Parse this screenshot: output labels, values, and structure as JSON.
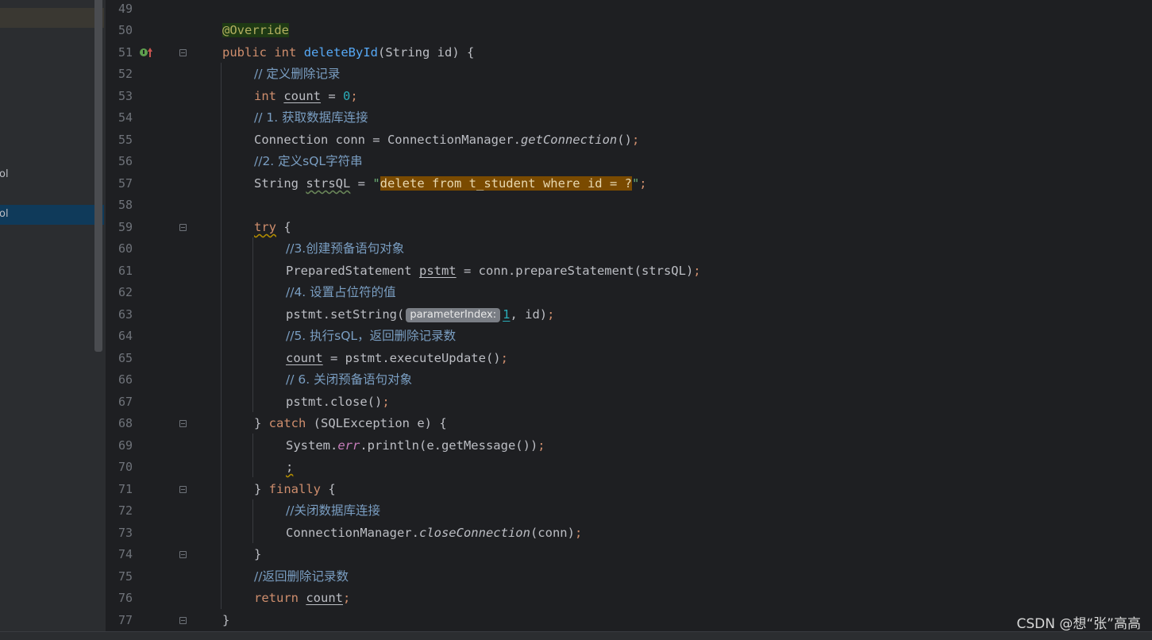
{
  "sidebar": {
    "items": [
      {
        "text": "ol"
      },
      {
        "text": "ol"
      }
    ]
  },
  "editor": {
    "lines": [
      {
        "num": "49"
      },
      {
        "num": "50"
      },
      {
        "num": "51"
      },
      {
        "num": "52"
      },
      {
        "num": "53"
      },
      {
        "num": "54"
      },
      {
        "num": "55"
      },
      {
        "num": "56"
      },
      {
        "num": "57"
      },
      {
        "num": "58"
      },
      {
        "num": "59"
      },
      {
        "num": "60"
      },
      {
        "num": "61"
      },
      {
        "num": "62"
      },
      {
        "num": "63"
      },
      {
        "num": "64"
      },
      {
        "num": "65"
      },
      {
        "num": "66"
      },
      {
        "num": "67"
      },
      {
        "num": "68"
      },
      {
        "num": "69"
      },
      {
        "num": "70"
      },
      {
        "num": "71"
      },
      {
        "num": "72"
      },
      {
        "num": "73"
      },
      {
        "num": "74"
      },
      {
        "num": "75"
      },
      {
        "num": "76"
      },
      {
        "num": "77"
      }
    ],
    "code": {
      "l50_annotation": "@Override",
      "l51_public": "public",
      "l51_int": "int",
      "l51_method": "deleteById",
      "l51_rest": "(String id) {",
      "l52_comment": "// 定义删除记录",
      "l53_int": "int",
      "l53_var": "count",
      "l53_eq": " = ",
      "l53_num": "0",
      "l53_semi": ";",
      "l54_comment": "// 1. 获取数据库连接",
      "l55_pre": "Connection conn = ConnectionManager.",
      "l55_call": "getConnection",
      "l55_post": "()",
      "l55_semi": ";",
      "l56_comment": "//2. 定义sQL字符串",
      "l57_pre": "String ",
      "l57_var": "strsQL",
      "l57_eq": " = ",
      "l57_quote_open": "\"",
      "l57_sql": "delete from t_student where id = ?",
      "l57_quote_close": "\"",
      "l57_semi": ";",
      "l59_try": "try",
      "l59_brace": " {",
      "l60_comment": "//3.创建预备语句对象",
      "l61_pre": "PreparedStatement ",
      "l61_var": "pstmt",
      "l61_post": " = conn.prepareStatement(strsQL)",
      "l61_semi": ";",
      "l62_comment": "//4. 设置占位符的值",
      "l63_pre": "pstmt.setString(",
      "l63_hint": "parameterIndex:",
      "l63_num": "1",
      "l63_post": ", id)",
      "l63_semi": ";",
      "l64_comment": "//5. 执行sQL，返回删除记录数",
      "l65_var": "count",
      "l65_post": " = pstmt.executeUpdate()",
      "l65_semi": ";",
      "l66_comment": "// 6. 关闭预备语句对象",
      "l67_pre": "pstmt.close()",
      "l67_semi": ";",
      "l68_pre": "} ",
      "l68_catch": "catch",
      "l68_post": " (SQLException e) {",
      "l69_pre": "System.",
      "l69_err": "err",
      "l69_post": ".println(e.getMessage())",
      "l69_semi": ";",
      "l70_semi": ";",
      "l71_pre": "} ",
      "l71_finally": "finally",
      "l71_post": " {",
      "l72_comment": "//关闭数据库连接",
      "l73_pre": "ConnectionManager.",
      "l73_call": "closeConnection",
      "l73_post": "(conn)",
      "l73_semi": ";",
      "l74_brace": "}",
      "l75_comment": "//返回删除记录数",
      "l76_return": "return",
      "l76_var": "count",
      "l76_semi": ";",
      "l77_brace": "}"
    }
  },
  "watermark": "CSDN @想“张”高高",
  "colors": {
    "background": "#1e1f22",
    "keyword": "#cf8e6d",
    "method": "#56a8f5",
    "number": "#2aacb8",
    "comment": "#7a9ec2",
    "string_highlight": "#7a4a00"
  }
}
